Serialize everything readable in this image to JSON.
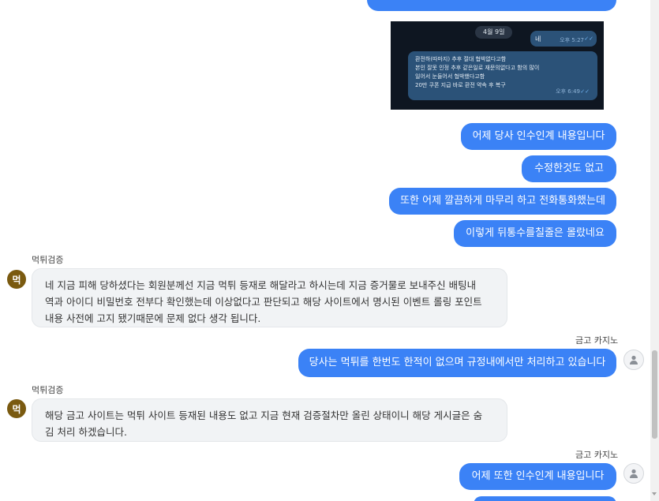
{
  "messages_right": [
    {
      "text": "어제 당사 인수인계 내용입니다"
    },
    {
      "text": "수정한것도 없고"
    },
    {
      "text": "또한 어제 깔끔하게 마무리 하고 전화통화했는데"
    },
    {
      "text": "이렇게 뒤통수를칠줄은 몰랐네요"
    },
    {
      "text": "당사는 먹튀를 한번도 한적이 없으며 규정내에서만 처리하고 있습니다"
    },
    {
      "text": "어제 또한 인수인계 내용입니다"
    }
  ],
  "messages_left": [
    {
      "sender": "먹튀검증",
      "avatar": "먹",
      "lines": [
        "네 지금 피해 당하셨다는 회원분께선 지금 먹튀 등재로 해달라고 하시는데 지금 증거물로 보내주신 배팅내",
        "역과 아이디 비밀번호 전부다 확인했는데 이상없다고 판단되고 해당 사이트에서 명시된 이벤트 롤링 포인트",
        "내용 사전에 고지 됐기때문에 문제 없다 생각 됩니다."
      ]
    },
    {
      "sender": "먹튀검증",
      "avatar": "먹",
      "lines": [
        "해당 금고 사이트는 먹튀 사이트 등재된 내용도 없고 지금 현재 검증절차만 올린 상태이니 해당 게시글은 숨",
        "김 처리 하겠습니다."
      ]
    }
  ],
  "user_sender": "금고 카지노",
  "screenshot": {
    "date": "4월 9일",
    "msg1": {
      "text": "네",
      "time": "오후 5:27"
    },
    "msg2": {
      "lines": [
        "환전하(따마지) 추후 절대 협박없다고함",
        "본인 잘못 인정 추후 같은일로 재문의없다고 함의 많이",
        "일어서 눈들어서 협박했다고함",
        "20만 쿠폰 지급 바로 환전 약속 후 복구"
      ],
      "time": "오후 6:49"
    }
  },
  "colors": {
    "accent": "#3b82f6",
    "avatar_bg": "#7a5a10",
    "bubble_gray": "#f1f3f5"
  }
}
